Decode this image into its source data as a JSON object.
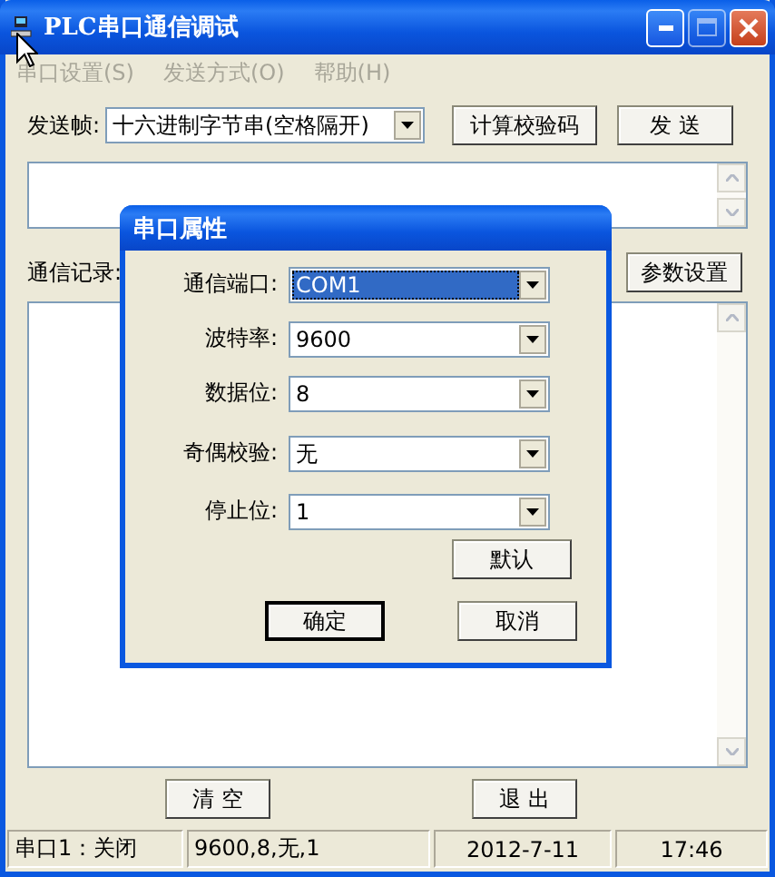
{
  "window": {
    "title": "PLC串口通信调试",
    "buttons": [
      {
        "kind": "minimize",
        "disabled": false
      },
      {
        "kind": "maximize",
        "disabled": true
      },
      {
        "kind": "close",
        "disabled": false
      }
    ]
  },
  "menu": [
    {
      "label": "串口设置(S)",
      "disabled": true
    },
    {
      "label": "发送方式(O)",
      "disabled": true
    },
    {
      "label": "帮助(H)",
      "disabled": true
    }
  ],
  "send_frame": {
    "label": "发送帧:",
    "value": "十六进制字节串(空格隔开)"
  },
  "send_buttons": [
    "计算校验码",
    "发 送"
  ],
  "log": {
    "label": "通信记录:",
    "button": "参数设置"
  },
  "bottom_buttons": [
    "清 空",
    "退 出"
  ],
  "status_bar": [
    "串口1：关闭",
    "9600,8,无,1",
    "2012-7-11",
    "17:46"
  ],
  "dialog": {
    "title": "串口属性",
    "fields": [
      {
        "label": "通信端口:",
        "value": "COM1",
        "selected": true
      },
      {
        "label": "波特率:",
        "value": "9600",
        "selected": false
      },
      {
        "label": "数据位:",
        "value": "8",
        "selected": false
      },
      {
        "label": "奇偶校验:",
        "value": "无",
        "selected": false
      },
      {
        "label": "停止位:",
        "value": "1",
        "selected": false
      }
    ],
    "default_button": "默认",
    "buttons": [
      {
        "label": "确定",
        "default": true
      },
      {
        "label": "取消",
        "default": false
      }
    ]
  }
}
